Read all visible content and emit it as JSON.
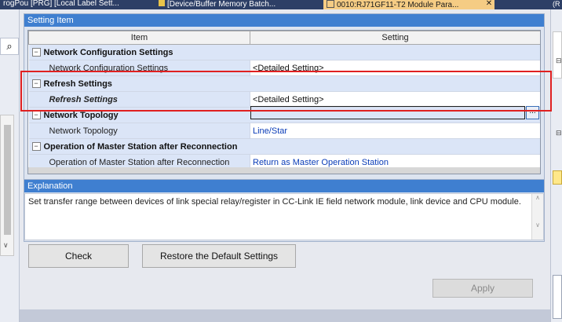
{
  "tabs": [
    {
      "label": "rogPou [PRG] [Local Label Sett..."
    },
    {
      "label": "[Device/Buffer Memory Batch..."
    },
    {
      "label": "0010:RJ71GF11-T2 Module Para..."
    }
  ],
  "setting_item": {
    "title": "Setting Item",
    "columns": {
      "item": "Item",
      "setting": "Setting"
    },
    "rows": [
      {
        "category": "Network Configuration Settings"
      },
      {
        "name": "Network Configuration Settings",
        "value": "<Detailed Setting>"
      },
      {
        "category": "Refresh Settings"
      },
      {
        "name": "Refresh Settings",
        "value": "<Detailed Setting>"
      },
      {
        "category": "Network Topology"
      },
      {
        "name": "Network Topology",
        "value": "Line/Star"
      },
      {
        "category": "Operation of Master Station after Reconnection"
      },
      {
        "name": "Operation of Master Station after Reconnection",
        "value": "Return as Master Operation Station"
      }
    ],
    "browse_label": "..."
  },
  "explanation": {
    "title": "Explanation",
    "text": "Set transfer range between devices of link special relay/register in CC-Link IE field network module, link device and CPU module."
  },
  "buttons": {
    "check": "Check",
    "restore": "Restore the Default Settings",
    "apply": "Apply"
  },
  "colors": {
    "header": "#3f7fd0",
    "highlight": "#e02020",
    "link_value": "#0b3db8"
  }
}
